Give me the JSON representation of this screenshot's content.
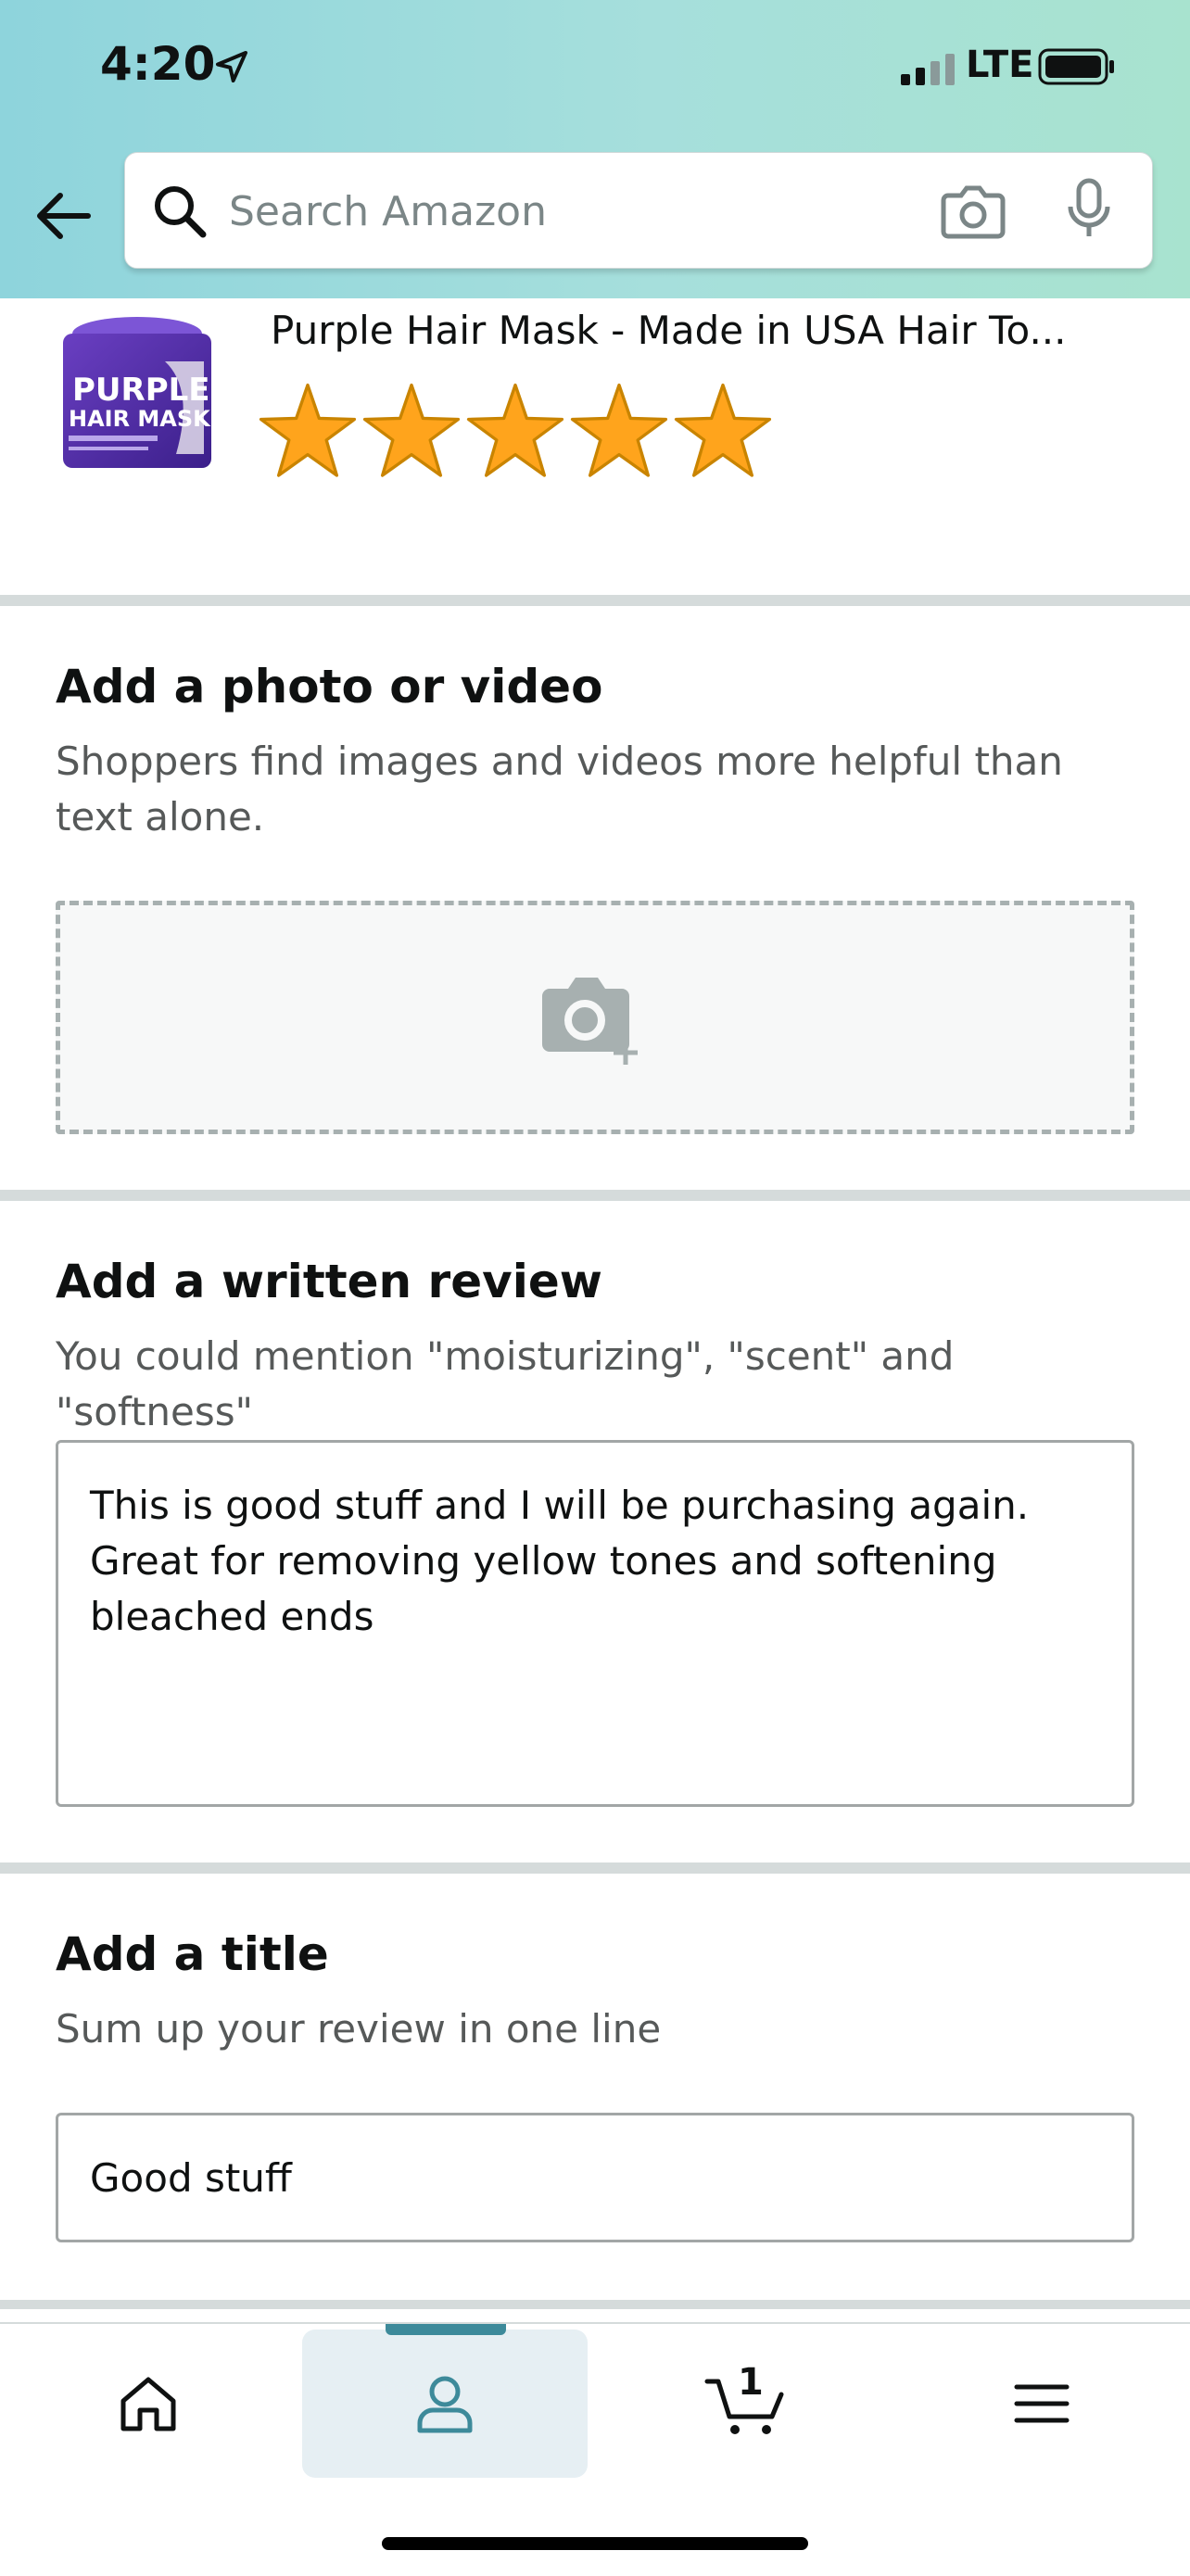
{
  "status_bar": {
    "time": "4:20",
    "network": "LTE"
  },
  "search": {
    "placeholder": "Search Amazon"
  },
  "product": {
    "thumb_text_line1": "PURPLE",
    "thumb_text_line2": "HAIR MASK",
    "title": "Purple Hair Mask - Made in USA Hair To...",
    "rating": 5,
    "max_rating": 5
  },
  "photo_section": {
    "title": "Add a photo or video",
    "subtitle": "Shoppers find images and videos more helpful than text alone."
  },
  "review_section": {
    "title": "Add a written review",
    "subtitle": "You could mention \"moisturizing\", \"scent\" and \"softness\"",
    "text": "This is good stuff and I will be purchasing again.\nGreat for removing yellow tones and softening bleached ends"
  },
  "title_section": {
    "title": "Add a title",
    "subtitle": "Sum up your review in one line",
    "value": "Good stuff"
  },
  "bottom_nav": {
    "items": [
      "home-icon",
      "account-icon",
      "cart-icon",
      "menu-icon"
    ],
    "active": "account-icon",
    "cart_count": "1"
  },
  "colors": {
    "header_gradient_start": "#8ed4dc",
    "header_gradient_end": "#a8e3cf",
    "star": "#ffa41c",
    "active_nav": "#3d8a9a",
    "divider": "#d5dbdb"
  }
}
